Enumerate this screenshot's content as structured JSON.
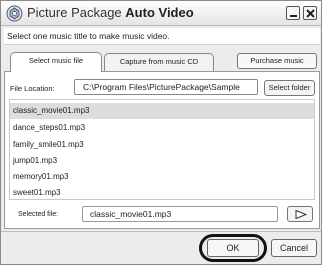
{
  "window": {
    "title_prefix": "Picture Package",
    "title_bold": "Auto Video",
    "icon": "app-icon",
    "controls": [
      "minimize-icon",
      "close-icon"
    ]
  },
  "instruction": "Select one music title to make music video.",
  "tabs": [
    {
      "label": "Select music file",
      "active": true
    },
    {
      "label": "Capture from music CD",
      "active": false
    }
  ],
  "purchase_label": "Purchase music",
  "location": {
    "label": "File Location:",
    "value": "C:\\Program Files\\PicturePackage\\Sample",
    "button": "Select folder"
  },
  "files": [
    {
      "name": "classic_movie01.mp3",
      "selected": true
    },
    {
      "name": "dance_steps01.mp3",
      "selected": false
    },
    {
      "name": "family_smile01.mp3",
      "selected": false
    },
    {
      "name": "jump01.mp3",
      "selected": false
    },
    {
      "name": "memory01.mp3",
      "selected": false
    },
    {
      "name": "sweet01.mp3",
      "selected": false
    }
  ],
  "selected_file": {
    "label": "Selected file:",
    "value": "classic_movie01.mp3",
    "play_icon": "play-icon"
  },
  "buttons": {
    "ok": "OK",
    "cancel": "Cancel"
  }
}
